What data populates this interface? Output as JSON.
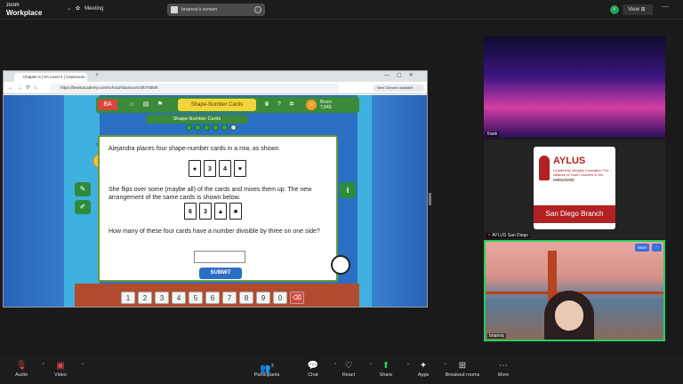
{
  "app": {
    "logo_line1": "zoom",
    "logo_line2": "Workplace",
    "meeting_label": "Meeting",
    "share_label": "brianna's screen",
    "view_label": "View"
  },
  "browser": {
    "tab_title": "Chapter 6 | 6A Level 4 | Classroom",
    "url": "https://beastacademy.com/school/classroom/4/b7055/6",
    "chrome_available": "New Chrome available"
  },
  "game": {
    "title": "Shape-Number Cards",
    "player_name": "Bruce",
    "player_score": "7,843",
    "question_1": "Alejandra places four shape-number cards in a row, as shown.",
    "cards_row1": [
      "●",
      "3",
      "4",
      "♥"
    ],
    "question_2": "She flips over some (maybe all) of the cards and mixes them up. The new arrangement of the same cards is shown below.",
    "cards_row2": [
      "6",
      "3",
      "▲",
      "■"
    ],
    "question_3": "How many of these four cards have a number divisible by three on one side?",
    "submit_label": "SUBMIT",
    "keypad": [
      "1",
      "2",
      "3",
      "4",
      "5",
      "6",
      "7",
      "8",
      "9",
      "0",
      "⌫"
    ]
  },
  "participants": [
    {
      "name": "frank"
    },
    {
      "name": "AYLUS San Diego"
    },
    {
      "name": "brianna"
    }
  ],
  "aylus_card": {
    "title": "AYLUS",
    "tagline": "Leadership Integrity Innovation The Alliance of Youth Leaders in the United States",
    "url": "www.aylus.org",
    "band": "San Diego Branch"
  },
  "tile_buttons": {
    "mute": "Mute",
    "more": "···"
  },
  "toolbar": [
    {
      "label": "Audio",
      "icon": "mic-muted-icon"
    },
    {
      "label": "Video",
      "icon": "video-off-icon"
    },
    {
      "label": "Participants",
      "icon": "participants-icon",
      "count": "3"
    },
    {
      "label": "Chat",
      "icon": "chat-icon"
    },
    {
      "label": "React",
      "icon": "heart-icon"
    },
    {
      "label": "Share",
      "icon": "share-icon"
    },
    {
      "label": "Apps",
      "icon": "apps-icon"
    },
    {
      "label": "Breakout rooms",
      "icon": "breakout-icon"
    },
    {
      "label": "More",
      "icon": "more-icon"
    }
  ],
  "colors": {
    "accent": "#2a6fc4",
    "share_green": "#23d05a",
    "muted_red": "#e04848"
  }
}
